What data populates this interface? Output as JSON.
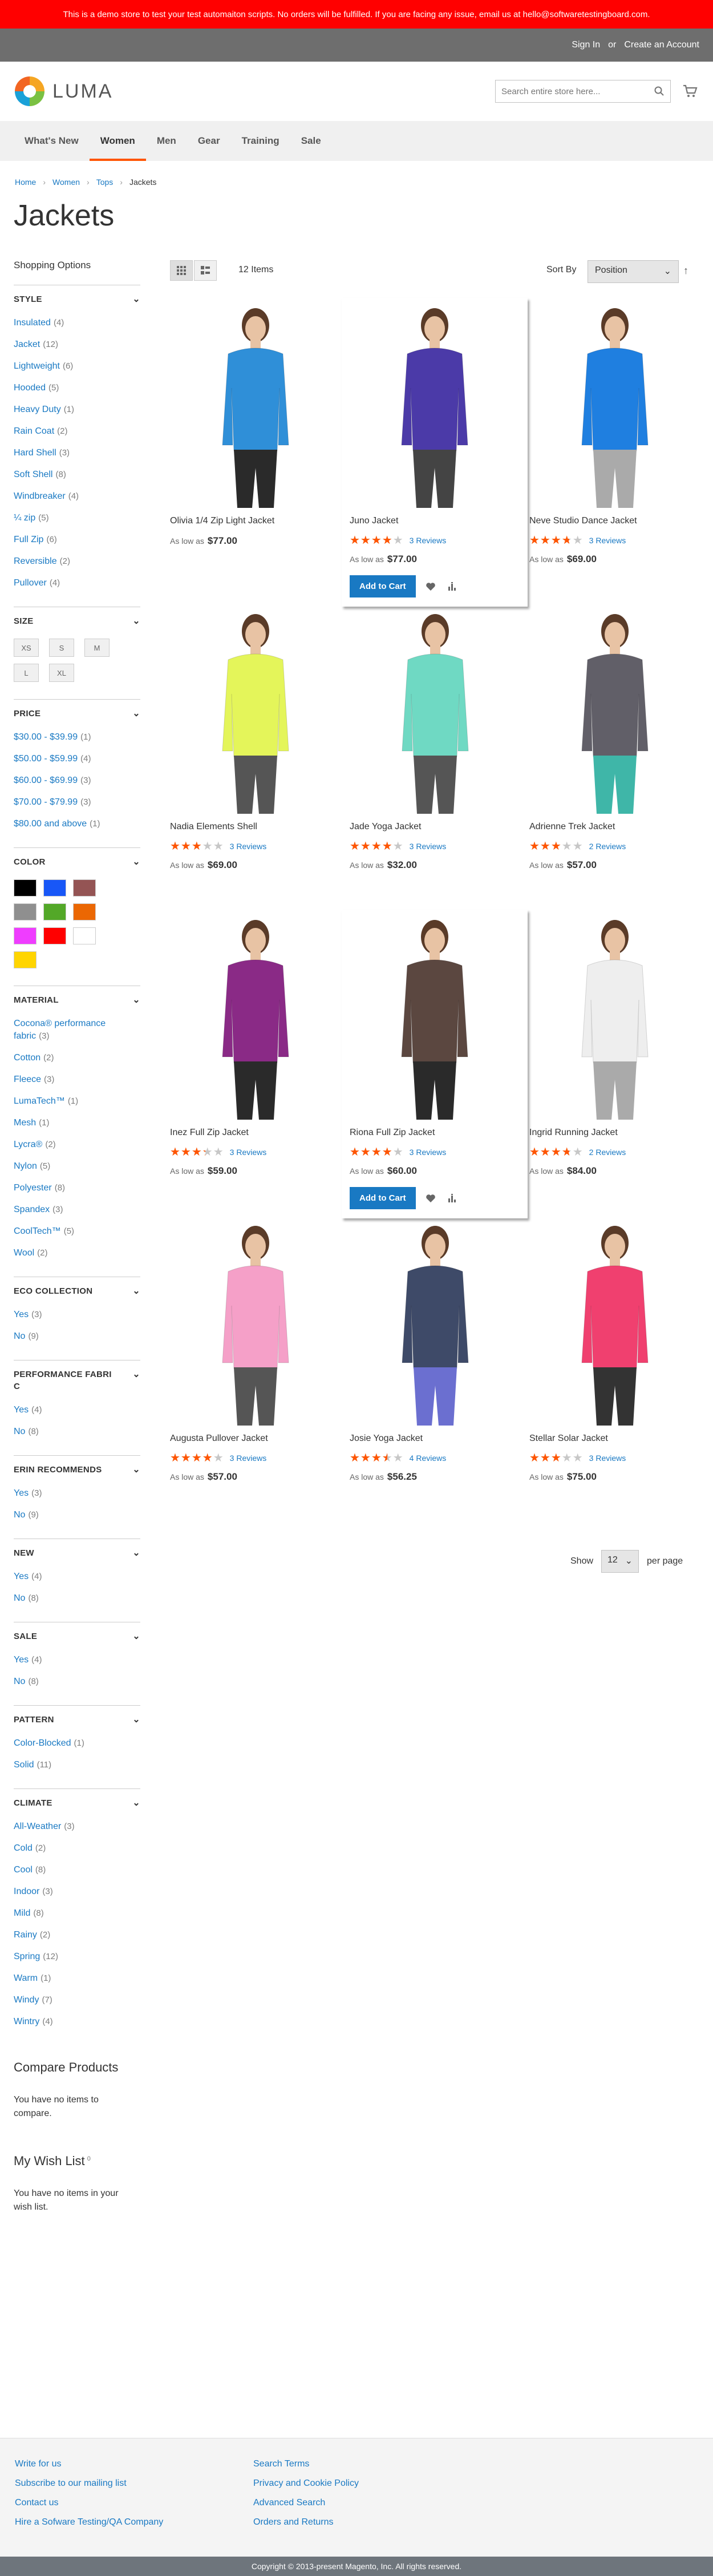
{
  "demo_notice": "This is a demo store to test your test automaiton scripts. No orders will be fulfilled. If you are facing any issue, email us at hello@softwaretestingboard.com.",
  "top_links": {
    "sign_in": "Sign In",
    "or": "or",
    "create_account": "Create an Account"
  },
  "logo": {
    "text": "LUMA"
  },
  "search": {
    "placeholder": "Search entire store here..."
  },
  "nav": [
    "What's New",
    "Women",
    "Men",
    "Gear",
    "Training",
    "Sale"
  ],
  "breadcrumbs": [
    "Home",
    "Women",
    "Tops",
    "Jackets"
  ],
  "page_title": "Jackets",
  "sidebar": {
    "shopping_options": "Shopping Options",
    "style": {
      "title": "STYLE",
      "options": [
        {
          "label": "Insulated",
          "count": "4"
        },
        {
          "label": "Jacket",
          "count": "12"
        },
        {
          "label": "Lightweight",
          "count": "6"
        },
        {
          "label": "Hooded",
          "count": "5"
        },
        {
          "label": "Heavy Duty",
          "count": "1"
        },
        {
          "label": "Rain Coat",
          "count": "2"
        },
        {
          "label": "Hard Shell",
          "count": "3"
        },
        {
          "label": "Soft Shell",
          "count": "8"
        },
        {
          "label": "Windbreaker",
          "count": "4"
        },
        {
          "label": "¼ zip",
          "count": "5"
        },
        {
          "label": "Full Zip",
          "count": "6"
        },
        {
          "label": "Reversible",
          "count": "2"
        },
        {
          "label": "Pullover",
          "count": "4"
        }
      ]
    },
    "size": {
      "title": "SIZE",
      "options": [
        "XS",
        "S",
        "M",
        "L",
        "XL"
      ]
    },
    "price": {
      "title": "PRICE",
      "options": [
        {
          "label": "$30.00 - $39.99",
          "count": "1"
        },
        {
          "label": "$50.00 - $59.99",
          "count": "4"
        },
        {
          "label": "$60.00 - $69.99",
          "count": "3"
        },
        {
          "label": "$70.00 - $79.99",
          "count": "3"
        },
        {
          "label": "$80.00 and above",
          "count": "1"
        }
      ]
    },
    "color": {
      "title": "COLOR",
      "swatches": [
        "#000000",
        "#1857f7",
        "#945454",
        "#8f8f8f",
        "#53a828",
        "#eb6703",
        "#ef3dff",
        "#ff0000",
        "#ffffff",
        "#ffd500"
      ]
    },
    "material": {
      "title": "MATERIAL",
      "options": [
        {
          "label": "Cocona® performance fabric",
          "count": "3"
        },
        {
          "label": "Cotton",
          "count": "2"
        },
        {
          "label": "Fleece",
          "count": "3"
        },
        {
          "label": "LumaTech™",
          "count": "1"
        },
        {
          "label": "Mesh",
          "count": "1"
        },
        {
          "label": "Lycra®",
          "count": "2"
        },
        {
          "label": "Nylon",
          "count": "5"
        },
        {
          "label": "Polyester",
          "count": "8"
        },
        {
          "label": "Spandex",
          "count": "3"
        },
        {
          "label": "CoolTech™",
          "count": "5"
        },
        {
          "label": "Wool",
          "count": "2"
        }
      ]
    },
    "eco": {
      "title": "ECO COLLECTION",
      "options": [
        {
          "label": "Yes",
          "count": "3"
        },
        {
          "label": "No",
          "count": "9"
        }
      ]
    },
    "performance": {
      "title": "PERFORMANCE FABRIC",
      "options": [
        {
          "label": "Yes",
          "count": "4"
        },
        {
          "label": "No",
          "count": "8"
        }
      ]
    },
    "erin": {
      "title": "ERIN RECOMMENDS",
      "options": [
        {
          "label": "Yes",
          "count": "3"
        },
        {
          "label": "No",
          "count": "9"
        }
      ]
    },
    "new": {
      "title": "NEW",
      "options": [
        {
          "label": "Yes",
          "count": "4"
        },
        {
          "label": "No",
          "count": "8"
        }
      ]
    },
    "sale": {
      "title": "SALE",
      "options": [
        {
          "label": "Yes",
          "count": "4"
        },
        {
          "label": "No",
          "count": "8"
        }
      ]
    },
    "pattern": {
      "title": "PATTERN",
      "options": [
        {
          "label": "Color-Blocked",
          "count": "1"
        },
        {
          "label": "Solid",
          "count": "11"
        }
      ]
    },
    "climate": {
      "title": "CLIMATE",
      "options": [
        {
          "label": "All-Weather",
          "count": "3"
        },
        {
          "label": "Cold",
          "count": "2"
        },
        {
          "label": "Cool",
          "count": "8"
        },
        {
          "label": "Indoor",
          "count": "3"
        },
        {
          "label": "Mild",
          "count": "8"
        },
        {
          "label": "Rainy",
          "count": "2"
        },
        {
          "label": "Spring",
          "count": "12"
        },
        {
          "label": "Warm",
          "count": "1"
        },
        {
          "label": "Windy",
          "count": "7"
        },
        {
          "label": "Wintry",
          "count": "4"
        }
      ]
    },
    "compare": {
      "title": "Compare Products",
      "text": "You have no items to compare."
    },
    "wishlist": {
      "title": "My Wish List",
      "count": "0",
      "text": "You have no items in your wish list."
    }
  },
  "toolbar": {
    "count": "12 Items",
    "sort_label": "Sort By",
    "sort_value": "Position",
    "show_label": "Show",
    "limit": "12",
    "per_page": "per page"
  },
  "labels": {
    "as_low_as": "As low as",
    "add_to_cart": "Add to Cart"
  },
  "products": [
    {
      "name": "Olivia 1/4 Zip Light Jacket",
      "price": "$77.00",
      "rating": 0,
      "reviews": "",
      "color": "#2f8fd8",
      "pants": "#2a2a2a"
    },
    {
      "name": "Juno Jacket",
      "price": "$77.00",
      "rating": 4,
      "reviews": "3 Reviews",
      "color": "#4b3aa8",
      "pants": "#444"
    },
    {
      "name": "Neve Studio Dance Jacket",
      "price": "$69.00",
      "rating": 3.7,
      "reviews": "3 Reviews",
      "color": "#1f7fe0",
      "pants": "#aaa"
    },
    {
      "name": "Nadia Elements Shell",
      "price": "$69.00",
      "rating": 3,
      "reviews": "3 Reviews",
      "color": "#e4f55a",
      "pants": "#555"
    },
    {
      "name": "Jade Yoga Jacket",
      "price": "$32.00",
      "rating": 4,
      "reviews": "3 Reviews",
      "color": "#6fd9c3",
      "pants": "#555"
    },
    {
      "name": "Adrienne Trek Jacket",
      "price": "$57.00",
      "rating": 3,
      "reviews": "2 Reviews",
      "color": "#615f68",
      "pants": "#3fb6a8"
    },
    {
      "name": "Inez Full Zip Jacket",
      "price": "$59.00",
      "rating": 3.3,
      "reviews": "3 Reviews",
      "color": "#8a2a86",
      "pants": "#2a2a2a"
    },
    {
      "name": "Riona Full Zip Jacket",
      "price": "$60.00",
      "rating": 4,
      "reviews": "3 Reviews",
      "color": "#5b4740",
      "pants": "#2a2a2a"
    },
    {
      "name": "Ingrid Running Jacket",
      "price": "$84.00",
      "rating": 3.7,
      "reviews": "2 Reviews",
      "color": "#eeeeee",
      "pants": "#aaa"
    },
    {
      "name": "Augusta Pullover Jacket",
      "price": "$57.00",
      "rating": 4,
      "reviews": "3 Reviews",
      "color": "#f5a0c8",
      "pants": "#555"
    },
    {
      "name": "Josie Yoga Jacket",
      "price": "$56.25",
      "rating": 3.5,
      "reviews": "4 Reviews",
      "color": "#3e4a68",
      "pants": "#6b6fd0"
    },
    {
      "name": "Stellar Solar Jacket",
      "price": "$75.00",
      "rating": 3,
      "reviews": "3 Reviews",
      "color": "#f0406f",
      "pants": "#333"
    }
  ],
  "footer": {
    "col1": [
      "Write for us",
      "Subscribe to our mailing list",
      "Contact us",
      "Hire a Sofware Testing/QA Company"
    ],
    "col2": [
      "Search Terms",
      "Privacy and Cookie Policy",
      "Advanced Search",
      "Orders and Returns"
    ],
    "copyright": "Copyright © 2013-present Magento, Inc. All rights reserved."
  }
}
